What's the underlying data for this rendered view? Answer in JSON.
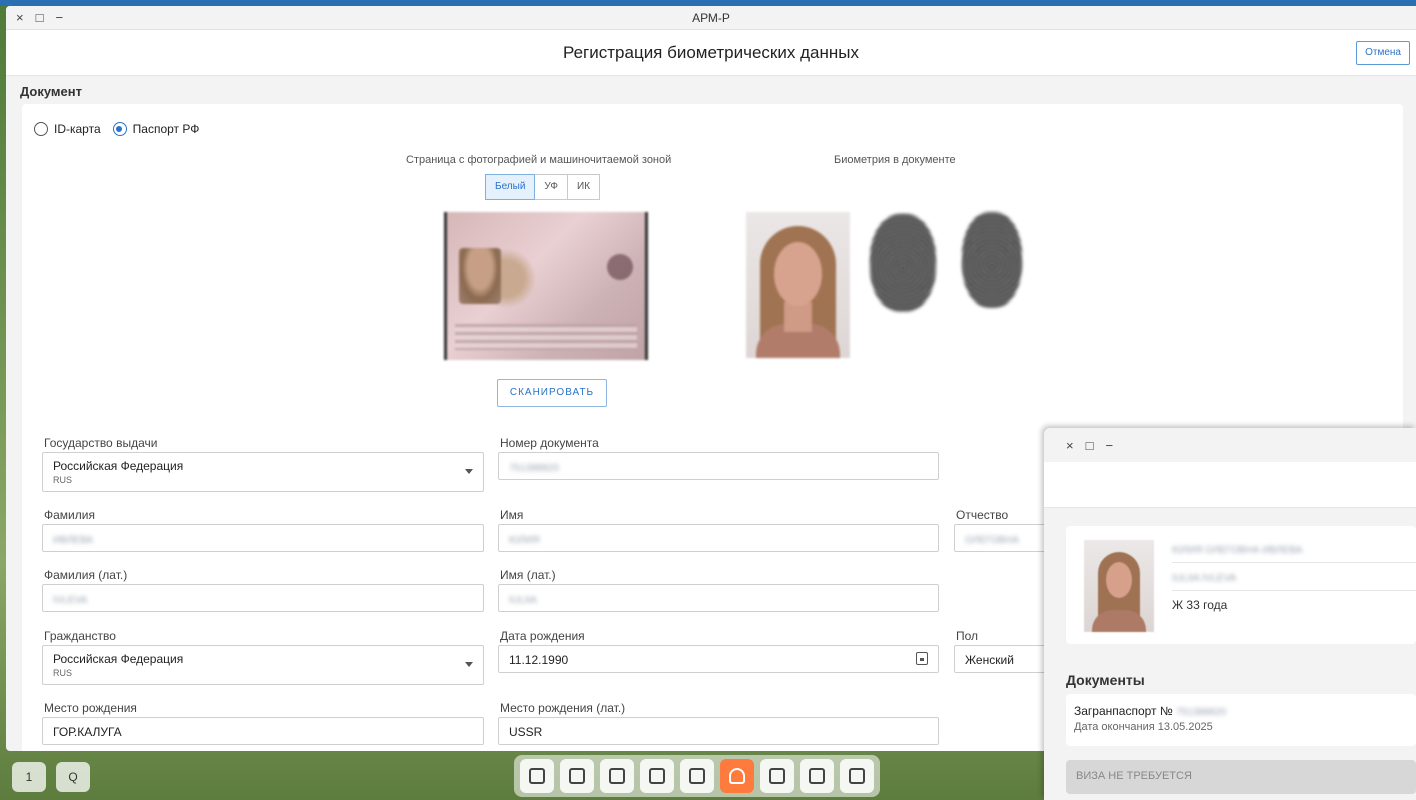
{
  "window": {
    "title": "АРМ-Р",
    "controls": [
      "×",
      "□",
      "−"
    ]
  },
  "header": {
    "title": "Регистрация биометрических данных",
    "cancel_label": "Отмена"
  },
  "section": {
    "label": "Документ"
  },
  "doc_type": {
    "options": [
      {
        "label": "ID-карта",
        "selected": false
      },
      {
        "label": "Паспорт РФ",
        "selected": true
      }
    ]
  },
  "captions": {
    "photo_page": "Страница с фотографией и машиночитаемой зоной",
    "biometry": "Биометрия в документе"
  },
  "light_modes": [
    {
      "label": "Белый",
      "active": true
    },
    {
      "label": "УФ",
      "active": false
    },
    {
      "label": "ИК",
      "active": false
    }
  ],
  "scan_label": "СКАНИРОВАТЬ",
  "form": {
    "issuing_state": {
      "label": "Государство выдачи",
      "value": "Российская Федерация",
      "sub": "RUS"
    },
    "doc_number": {
      "label": "Номер документа",
      "value": "751388820"
    },
    "surname": {
      "label": "Фамилия",
      "value": "ИВЛЕВА"
    },
    "name": {
      "label": "Имя",
      "value": "ЮЛИЯ"
    },
    "patronymic": {
      "label": "Отчество",
      "value": "ОЛЕГОВНА"
    },
    "surname_lat": {
      "label": "Фамилия (лат.)",
      "value": "IVLEVA"
    },
    "name_lat": {
      "label": "Имя (лат.)",
      "value": "IULIIA"
    },
    "citizenship": {
      "label": "Гражданство",
      "value": "Российская Федерация",
      "sub": "RUS"
    },
    "birth_date": {
      "label": "Дата рождения",
      "value": "11.12.1990"
    },
    "sex": {
      "label": "Пол",
      "value": "Женский"
    },
    "birth_place": {
      "label": "Место рождения",
      "value": "ГОР.КАЛУГА"
    },
    "birth_place_lat": {
      "label": "Место рождения (лат.)",
      "value": "USSR"
    }
  },
  "dock_left": [
    "1",
    "Q"
  ],
  "side_window": {
    "controls": [
      "×",
      "□",
      "−"
    ],
    "person": {
      "full_name": "ЮЛИЯ ОЛЕГОВНА ИВЛЕВА",
      "latin_name": "IULIIA IVLEVA",
      "summary": "Ж 33 года"
    },
    "documents_title": "Документы",
    "document": {
      "title": "Загранпаспорт №",
      "number": "751388820",
      "expiry": "Дата окончания 13.05.2025"
    },
    "visa_label": "ВИЗА НЕ ТРЕБУЕТСЯ"
  }
}
